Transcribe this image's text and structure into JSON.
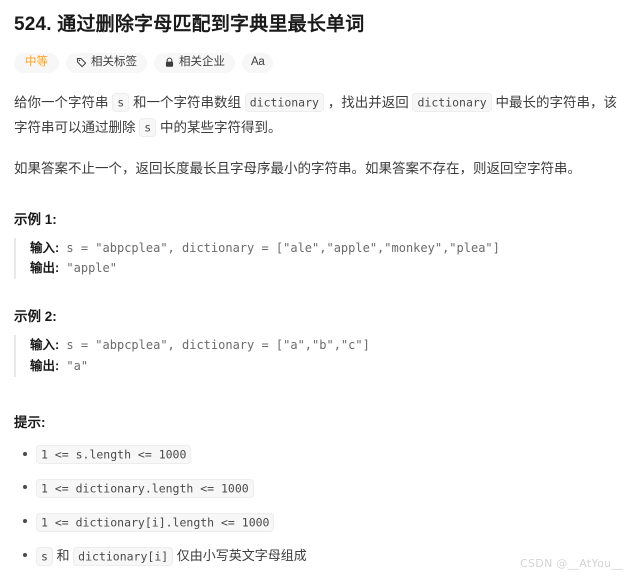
{
  "problem": {
    "title": "524. 通过删除字母匹配到字典里最长单词",
    "badges": [
      {
        "label": "中等",
        "icon": "none",
        "type": "difficulty"
      },
      {
        "label": "相关标签",
        "icon": "tag-icon",
        "type": "normal"
      },
      {
        "label": "相关企业",
        "icon": "lock-icon",
        "type": "normal"
      },
      {
        "label": "Aa",
        "icon": "font-size-icon",
        "type": "square"
      }
    ],
    "description": {
      "p1": {
        "t1": "给你一个字符串 ",
        "c1": "s",
        "t2": " 和一个字符串数组 ",
        "c2": "dictionary",
        "t3": " ，找出并返回 ",
        "c3": "dictionary",
        "t4": " 中最长的字符串，该字符串可以通过删除 ",
        "c4": "s",
        "t5": " 中的某些字符得到。"
      },
      "p2": "如果答案不止一个，返回长度最长且字母序最小的字符串。如果答案不存在，则返回空字符串。"
    },
    "examples": [
      {
        "heading": "示例 1:",
        "input_label": "输入:",
        "input_value": " s = \"abpcplea\", dictionary = [\"ale\",\"apple\",\"monkey\",\"plea\"]",
        "output_label": "输出:",
        "output_value": " \"apple\""
      },
      {
        "heading": "示例 2:",
        "input_label": "输入:",
        "input_value": " s = \"abpcplea\", dictionary = [\"a\",\"b\",\"c\"]",
        "output_label": "输出:",
        "output_value": " \"a\""
      }
    ],
    "hints": {
      "heading": "提示:",
      "items": [
        {
          "code": "1 <= s.length <= 1000",
          "text": ""
        },
        {
          "code": "1 <= dictionary.length <= 1000",
          "text": ""
        },
        {
          "code": "1 <= dictionary[i].length <= 1000",
          "text": ""
        },
        {
          "code": "s",
          "mid": " 和 ",
          "code2": "dictionary[i]",
          "text": " 仅由小写英文字母组成"
        }
      ]
    }
  },
  "watermark": "CSDN @__AtYou__",
  "colors": {
    "difficulty_orange": "#ffa116",
    "badge_bg": "#f7f7f7",
    "code_bg": "#f7f7f7",
    "text": "#3c3c3c",
    "heading": "#1a1a1a"
  }
}
